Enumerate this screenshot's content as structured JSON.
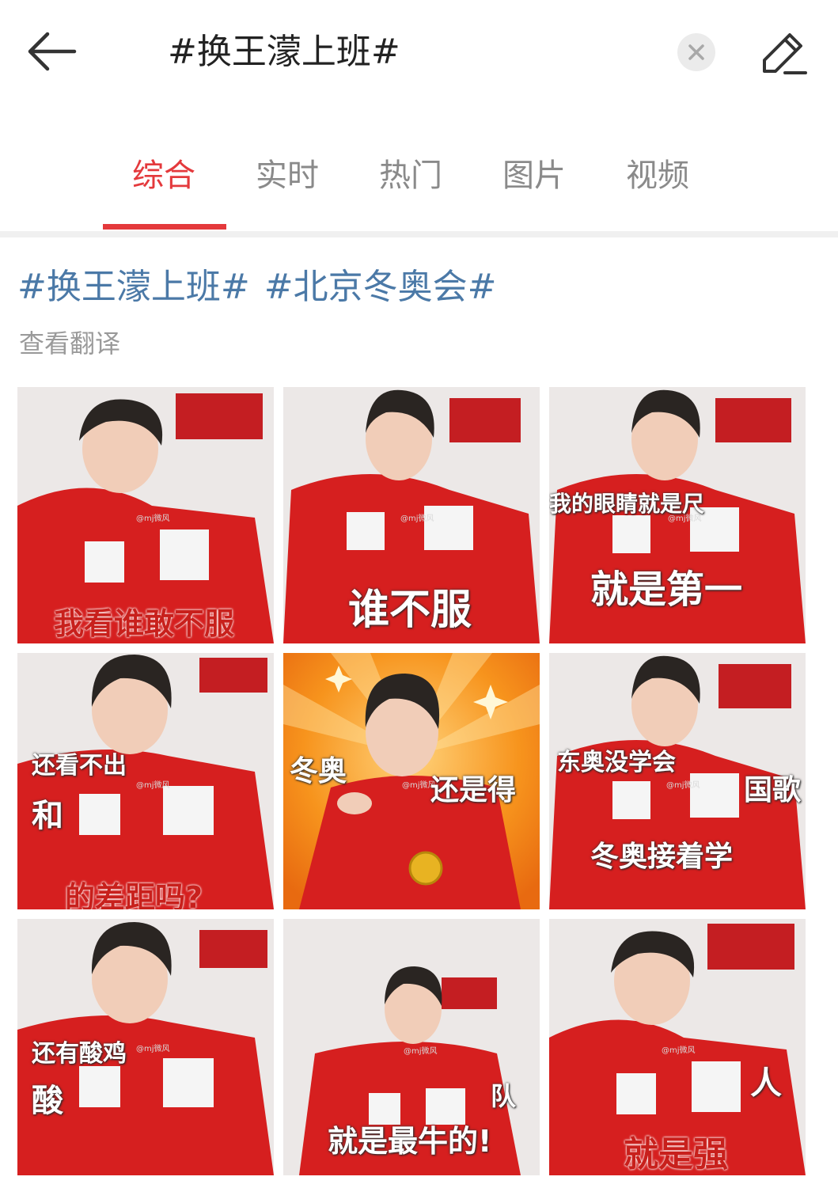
{
  "header": {
    "query": "#换王濛上班#",
    "back_icon": "arrow-left-icon",
    "clear_icon": "close-icon",
    "edit_icon": "pencil-icon"
  },
  "tabs": [
    {
      "label": "综合",
      "active": true
    },
    {
      "label": "实时",
      "active": false
    },
    {
      "label": "热门",
      "active": false
    },
    {
      "label": "图片",
      "active": false
    },
    {
      "label": "视频",
      "active": false
    }
  ],
  "colors": {
    "accent": "#e4393c",
    "hashtag": "#4b79a7",
    "jacket": "#d61f1f"
  },
  "post": {
    "hashtags": [
      "#换王濛上班#",
      "#北京冬奥会#"
    ],
    "translate_label": "查看翻译",
    "watermark": "@mj微风",
    "images": [
      {
        "captions": [
          "我看谁敢不服"
        ]
      },
      {
        "captions": [
          "谁不服"
        ]
      },
      {
        "captions": [
          "我的眼睛就是尺",
          "就是第一"
        ]
      },
      {
        "captions": [
          "还看不出",
          "和",
          "的差距吗?"
        ]
      },
      {
        "captions": [
          "冬奥",
          "还是得"
        ]
      },
      {
        "captions": [
          "东奥没学会",
          "国歌",
          "冬奥接着学"
        ]
      },
      {
        "captions": [
          "还有酸鸡",
          "酸"
        ]
      },
      {
        "captions": [
          "队",
          "就是最牛的!"
        ]
      },
      {
        "captions": [
          "人",
          "就是强"
        ]
      }
    ]
  }
}
